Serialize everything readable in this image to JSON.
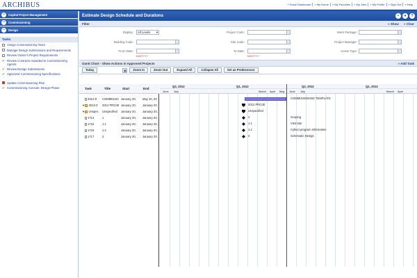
{
  "app": {
    "logo": "ARCHIBUS",
    "top_links": [
      "» Show Dashboard",
      "» My Home",
      "» My Favorites",
      "» My Jobs",
      "» My Profile",
      "» Sign Out",
      "» Help"
    ]
  },
  "sidebar": {
    "sections": [
      "Capital Project Management",
      "Commissioning",
      "Design"
    ],
    "tasks_title": "Tasks",
    "tasks": [
      {
        "label": "Assign Commissioning Team",
        "icon": "box"
      },
      {
        "label": "Manage Design Submissions and Requirements",
        "icon": "box"
      },
      {
        "label": "Review Owner's Project Requirements",
        "icon": "box"
      },
      {
        "label": "Review Contracts Awarded to Commissioning Agents",
        "icon": "check"
      },
      {
        "label": "Review Design Submissions",
        "icon": "check"
      },
      {
        "label": "Approved Commissioning Specifications",
        "icon": "check"
      },
      {
        "label": "Update Commissioning Plan",
        "icon": "red"
      },
      {
        "label": "Commissioning Console: Design Phase",
        "icon": "check"
      }
    ]
  },
  "main": {
    "title": "Estimate Design Schedule and Durations",
    "filter": {
      "title": "Filter",
      "show_label": "» Show",
      "clear_label": "» Clear",
      "display_label": "Display:",
      "display_value": "All Levels",
      "building_code_label": "Building Code:",
      "from_date_label": "From Date:",
      "from_hint": "M/D/YYYY",
      "project_code_label": "Project Code:",
      "site_code_label": "Site Code:",
      "to_date_label": "To Date:",
      "to_hint": "M/D/YYYY",
      "work_package_label": "Work Package:",
      "project_manager_label": "Project Manager:",
      "action_type_label": "Action Type:"
    },
    "gantt": {
      "title": "Gantt Chart - Show Actions in Approved Projects",
      "add_task": "» Add Task",
      "toolbar": {
        "today": "Today",
        "zoom_in": "Zoom In",
        "zoom_out": "Zoom Out",
        "expand_all": "Expand All",
        "collapse_all": "Collapse All",
        "set_predecessor": "Set as Predecessor"
      },
      "columns": [
        "Task",
        "Title",
        "Start",
        "End"
      ],
      "quarters": [
        "Q2, 2012",
        "Q1, 2012",
        "Q2, 2012",
        "Q1, 2013"
      ],
      "months": [
        "June",
        "July",
        "March",
        "April",
        "May",
        "June",
        "July",
        "March",
        "April"
      ],
      "rows": [
        {
          "task": "2012-0",
          "title": "COMMISSIC",
          "start": "January 20,",
          "end": "May 20, 20",
          "type": "doc",
          "arrow": "",
          "label": "COMMISSIONING TEMPLATE"
        },
        {
          "task": "2012-0",
          "title": "2012 PROJE",
          "start": "January 20,",
          "end": "January 20,",
          "type": "folder",
          "arrow": "▼",
          "label": "2012 PROJE"
        },
        {
          "task": "Unspec",
          "title": "Unspecified",
          "start": "January 20,",
          "end": "January 20,",
          "type": "folder",
          "arrow": "▼",
          "label": "Unspecified"
        },
        {
          "task": "1714",
          "title": "1",
          "start": "January 20,",
          "end": "January 20,",
          "type": "doc",
          "arrow": "",
          "label": "1",
          "note": "Scoping"
        },
        {
          "task": "1715",
          "title": "1.1",
          "start": "January 20,",
          "end": "January 20,",
          "type": "doc",
          "arrow": "",
          "label": "1.1",
          "note": "Visit Site"
        },
        {
          "task": "1716",
          "title": "1.2",
          "start": "January 20,",
          "end": "January 20,",
          "type": "doc",
          "arrow": "",
          "label": "1.2",
          "note": "Collect program information"
        },
        {
          "task": "1717",
          "title": "2",
          "start": "January 20,",
          "end": "January 20,",
          "type": "doc",
          "arrow": "",
          "label": "2",
          "note": "Schematic Design"
        }
      ]
    }
  },
  "colors": {
    "brand_blue": "#1d4c9c",
    "bar_purple": "#7f7ae0"
  }
}
